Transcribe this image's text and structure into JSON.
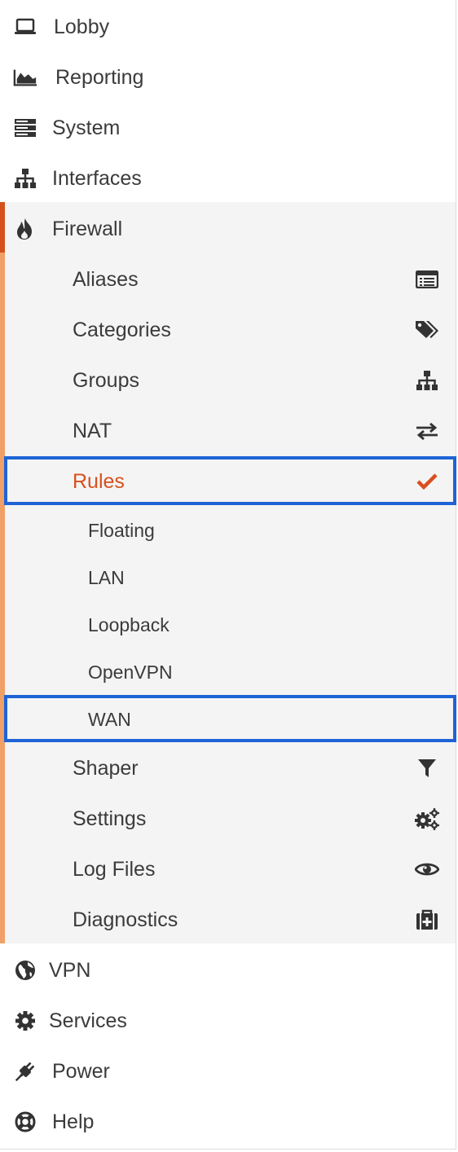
{
  "menu": {
    "top": [
      {
        "label": "Lobby",
        "icon": "laptop-icon"
      },
      {
        "label": "Reporting",
        "icon": "area-chart-icon"
      },
      {
        "label": "System",
        "icon": "server-icon"
      },
      {
        "label": "Interfaces",
        "icon": "sitemap-icon"
      },
      {
        "label": "Firewall",
        "icon": "fire-icon"
      }
    ],
    "firewall_items": [
      {
        "label": "Aliases",
        "icon": "list-alt-icon"
      },
      {
        "label": "Categories",
        "icon": "tags-icon"
      },
      {
        "label": "Groups",
        "icon": "sitemap-icon"
      },
      {
        "label": "NAT",
        "icon": "exchange-icon"
      },
      {
        "label": "Rules",
        "icon": "check-icon"
      }
    ],
    "rules_items": [
      {
        "label": "Floating"
      },
      {
        "label": "LAN"
      },
      {
        "label": "Loopback"
      },
      {
        "label": "OpenVPN"
      },
      {
        "label": "WAN"
      }
    ],
    "firewall_items_2": [
      {
        "label": "Shaper",
        "icon": "filter-icon"
      },
      {
        "label": "Settings",
        "icon": "cogs-icon"
      },
      {
        "label": "Log Files",
        "icon": "eye-icon"
      },
      {
        "label": "Diagnostics",
        "icon": "medkit-icon"
      }
    ],
    "bottom": [
      {
        "label": "VPN",
        "icon": "globe-icon"
      },
      {
        "label": "Services",
        "icon": "cog-icon"
      },
      {
        "label": "Power",
        "icon": "plug-icon"
      },
      {
        "label": "Help",
        "icon": "life-ring-icon"
      }
    ]
  },
  "colors": {
    "accent": "#d4511e",
    "accent_light": "#f0a066",
    "active_text": "#d94f1e",
    "highlight_box": "#1f63d6",
    "submenu_bg": "#f4f4f4"
  }
}
